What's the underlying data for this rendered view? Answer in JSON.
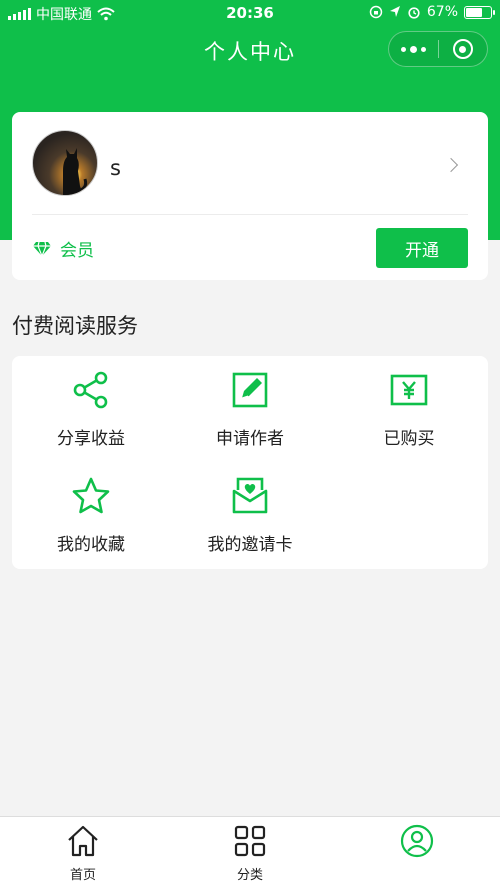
{
  "status_bar": {
    "carrier": "中国联通",
    "time": "20:36",
    "battery": "67%",
    "battery_level": 0.67
  },
  "nav": {
    "title": "个人中心"
  },
  "profile": {
    "username": "s",
    "member_label": "会员",
    "open_button": "开通"
  },
  "services": {
    "section_title": "付费阅读服务",
    "items": [
      {
        "label": "分享收益",
        "icon": "share-icon"
      },
      {
        "label": "申请作者",
        "icon": "edit-icon"
      },
      {
        "label": "已购买",
        "icon": "yen-icon"
      },
      {
        "label": "我的收藏",
        "icon": "star-icon"
      },
      {
        "label": "我的邀请卡",
        "icon": "invite-card-icon"
      }
    ]
  },
  "tab_bar": {
    "items": [
      {
        "label": "首页",
        "icon": "home-icon"
      },
      {
        "label": "分类",
        "icon": "grid-icon"
      },
      {
        "label": "",
        "icon": "user-icon",
        "active": true
      }
    ]
  },
  "colors": {
    "accent": "#0fbf4a",
    "background": "#f3f3f3"
  }
}
